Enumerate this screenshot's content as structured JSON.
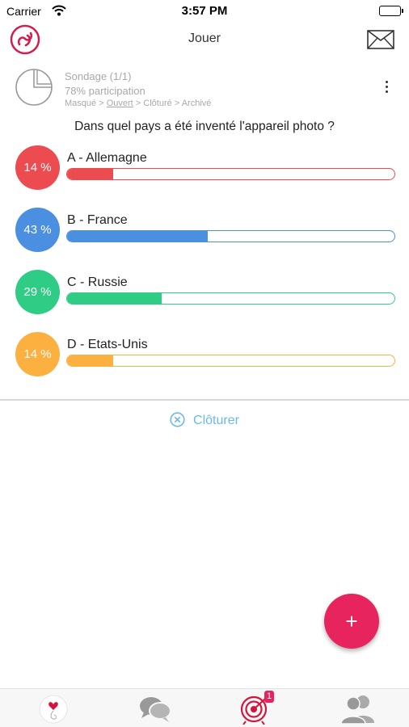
{
  "status_bar": {
    "carrier": "Carrier",
    "time": "3:57 PM"
  },
  "nav": {
    "title": "Jouer",
    "logo_icon": "app-logo-icon",
    "mail_icon": "envelope-icon"
  },
  "poll": {
    "title": "Sondage (1/1)",
    "participation": "78% participation",
    "breadcrumb": {
      "masque": "Masqué",
      "ouvert": "Ouvert",
      "cloture": "Clôturé",
      "archive": "Archivé",
      "separator": ">"
    },
    "question": "Dans quel pays a été inventé l'appareil photo ?"
  },
  "answers": [
    {
      "label": "A - Allemagne",
      "percent_text": "14 %",
      "value": 14,
      "color": "#ec4b50"
    },
    {
      "label": "B - France",
      "percent_text": "43 %",
      "value": 43,
      "color": "#4a8fe0"
    },
    {
      "label": "C - Russie",
      "percent_text": "29 %",
      "value": 29,
      "color": "#2fcc86"
    },
    {
      "label": "D - Etats-Unis",
      "percent_text": "14 %",
      "value": 14,
      "color": "#fbb040"
    }
  ],
  "actions": {
    "close_label": "Clôturer",
    "fab_label": "+"
  },
  "tabbar": {
    "items": [
      {
        "icon": "heart-profile-icon"
      },
      {
        "icon": "chat-bubbles-icon"
      },
      {
        "icon": "target-icon",
        "badge": "1"
      },
      {
        "icon": "users-icon"
      }
    ]
  },
  "colors": {
    "accent": "#e8245e",
    "link": "#6bb8ea"
  }
}
